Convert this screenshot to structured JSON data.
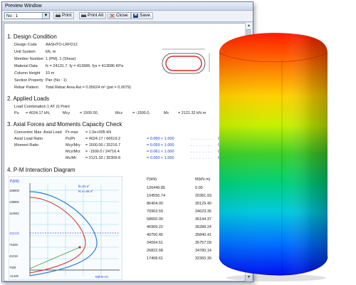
{
  "window": {
    "title": "Preview Window"
  },
  "toolbar": {
    "selector_value": "No : 1",
    "print_label": "Print",
    "print_all_label": "Print All",
    "close_label": "Close",
    "save_label": "Save"
  },
  "report": {
    "sec1": {
      "heading": "1. Design Condition",
      "rows": [
        {
          "label": "Design Code",
          "value": "AASHTO-LRFD12"
        },
        {
          "label": "Unit System",
          "value": "kN, m"
        },
        {
          "label": "Member Number",
          "value": "1 (PM), 1 (Shear)"
        },
        {
          "label": "Material Data",
          "value": "fc = 24131.7,  fy = 413686,  fys = 413686 KPa"
        },
        {
          "label": "Column Height",
          "value": "10 m"
        },
        {
          "label": "Section Property",
          "value": "Pier (No : 1)"
        },
        {
          "label": "Rebar Pattern",
          "value": "Total Rebar Area  Ast = 0.05624 m²  (pst = 0.0079)"
        }
      ]
    },
    "sec2": {
      "heading": "2. Applied Loads",
      "load_combination": "Load Combination      1  AT (I) Point",
      "pu_label": "Pu",
      "pu_value": "= 4024.17  kN,",
      "mcy_label": "Mcy",
      "mcy_value": "=   1500.00,",
      "mcz_label": "Mcz",
      "mcz_value": "=  -1500.0,",
      "mc_label": "Mc",
      "mc_value": "=  2121.32  kN·m"
    },
    "sec3": {
      "heading": "3. Axial Forces and Moments Capacity Check",
      "rows": [
        {
          "label": "Concentric Max. Axial Load",
          "sym": "Pr-max",
          "expr": "=  1.0e+005  kN",
          "check": "",
          "status": ""
        },
        {
          "label": "Axial Load Ratio",
          "sym": "Pu/Pr",
          "expr": "=  4024.17  /  66619.2",
          "check": "=  0.060   <  1.000",
          "status": "O.K"
        },
        {
          "label": "Moment Ratio",
          "sym": "Mcy/Mry",
          "expr": "=  1500.00  /  25216.7",
          "check": "=  0.059   <  1.000",
          "status": "O.K"
        },
        {
          "label": "",
          "sym": "Mcz/Mrz",
          "expr": "=  -1500.0  /  24716.4",
          "check": "=  0.061   <  1.000",
          "status": "O.K"
        },
        {
          "label": "",
          "sym": "Mc/Mr",
          "expr": "=  2121.32  /  35309.8",
          "check": "=  0.060   <  1.000",
          "status": "O.K"
        }
      ]
    },
    "sec4": {
      "heading": "4. P-M Interaction Diagram",
      "y_axis_label": "P(kN)",
      "x_axis_label": "M(kN·m)",
      "legend_line1": "θ=44.4°",
      "legend_line2": "N.A=45.4°",
      "y_ticks": [
        "166600",
        "138991",
        "114842",
        "102132",
        "71629",
        "41219",
        "7026",
        "-11429"
      ],
      "table_headers": [
        "P(kN)",
        "M(kN·m)"
      ],
      "table_rows": [
        [
          "126449.85",
          "0.00"
        ],
        [
          "104556.74",
          "20381.93"
        ],
        [
          "86404.00",
          "30129.40"
        ],
        [
          "70963.59",
          "34623.35"
        ],
        [
          "58650.00",
          "36144.37"
        ],
        [
          "46909.22",
          "36288.24"
        ],
        [
          "40750.45",
          "35840.41"
        ],
        [
          "34094.51",
          "35757.09"
        ],
        [
          "26822.68",
          "34780.14"
        ],
        [
          "17468.61",
          "32365.39"
        ]
      ]
    }
  },
  "colors": {
    "accent_blue": "#1a3fd6",
    "rebar_red": "#d62a2a"
  }
}
